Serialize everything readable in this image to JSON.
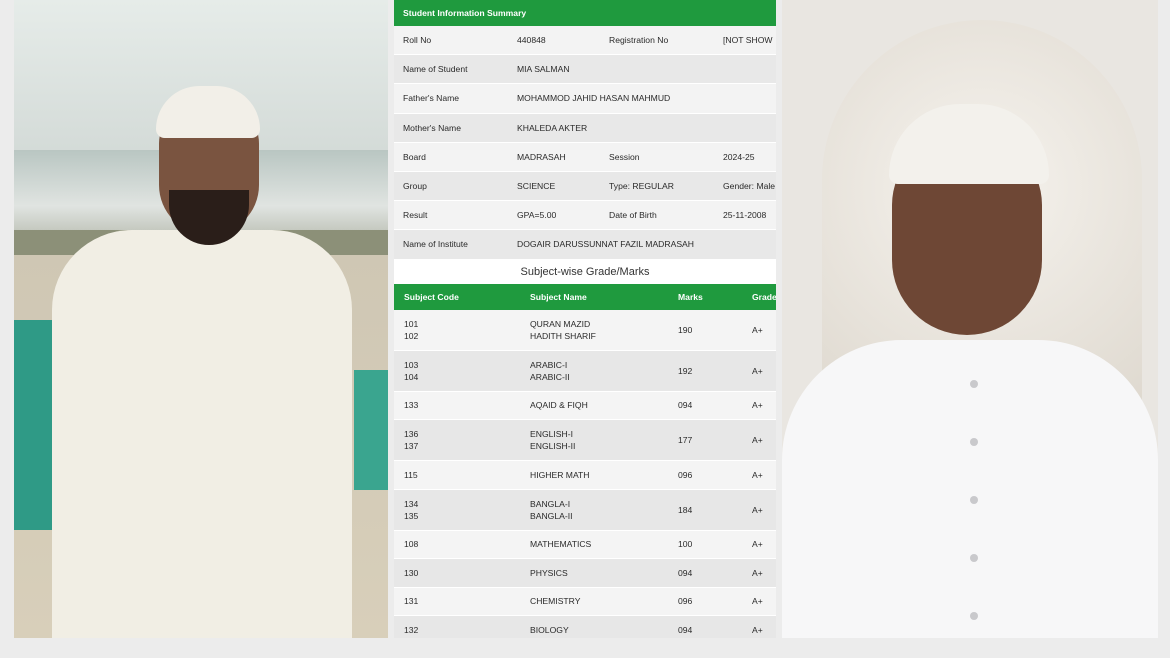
{
  "summary": {
    "title": "Student Information Summary",
    "roll_label": "Roll No",
    "roll_value": "440848",
    "reg_label": "Registration No",
    "reg_value": "[NOT SHOW",
    "name_label": "Name of Student",
    "name_value": "MIA SALMAN",
    "father_label": "Father's Name",
    "father_value": "MOHAMMOD JAHID HASAN MAHMUD",
    "mother_label": "Mother's Name",
    "mother_value": "KHALEDA AKTER",
    "board_label": "Board",
    "board_value": "MADRASAH",
    "session_label": "Session",
    "session_value": "2024-25",
    "group_label": "Group",
    "group_value": "SCIENCE",
    "type_value": "Type: REGULAR",
    "gender_value": "Gender: Male",
    "result_label": "Result",
    "result_value": "GPA=5.00",
    "dob_label": "Date of Birth",
    "dob_value": "25-11-2008",
    "institute_label": "Name of Institute",
    "institute_value": "DOGAIR DARUSSUNNAT FAZIL MADRASAH"
  },
  "marks": {
    "section_title": "Subject-wise Grade/Marks",
    "headers": [
      "Subject Code",
      "Subject Name",
      "Marks",
      "Grade"
    ],
    "rows": [
      {
        "code1": "101",
        "code2": "102",
        "name1": "QURAN MAZID",
        "name2": "HADITH SHARIF",
        "marks": "190",
        "grade": "A+"
      },
      {
        "code1": "103",
        "code2": "104",
        "name1": "ARABIC-I",
        "name2": "ARABIC-II",
        "marks": "192",
        "grade": "A+"
      },
      {
        "code1": "133",
        "code2": "",
        "name1": "AQAID & FIQH",
        "name2": "",
        "marks": "094",
        "grade": "A+"
      },
      {
        "code1": "136",
        "code2": "137",
        "name1": "ENGLISH-I",
        "name2": "ENGLISH-II",
        "marks": "177",
        "grade": "A+"
      },
      {
        "code1": "115",
        "code2": "",
        "name1": "HIGHER MATH",
        "name2": "",
        "marks": "096",
        "grade": "A+"
      },
      {
        "code1": "134",
        "code2": "135",
        "name1": "BANGLA-I",
        "name2": "BANGLA-II",
        "marks": "184",
        "grade": "A+"
      },
      {
        "code1": "108",
        "code2": "",
        "name1": "MATHEMATICS",
        "name2": "",
        "marks": "100",
        "grade": "A+"
      },
      {
        "code1": "130",
        "code2": "",
        "name1": "PHYSICS",
        "name2": "",
        "marks": "094",
        "grade": "A+"
      },
      {
        "code1": "131",
        "code2": "",
        "name1": "CHEMISTRY",
        "name2": "",
        "marks": "096",
        "grade": "A+"
      },
      {
        "code1": "132",
        "code2": "",
        "name1": "BIOLOGY",
        "name2": "",
        "marks": "094",
        "grade": "A+"
      }
    ]
  }
}
